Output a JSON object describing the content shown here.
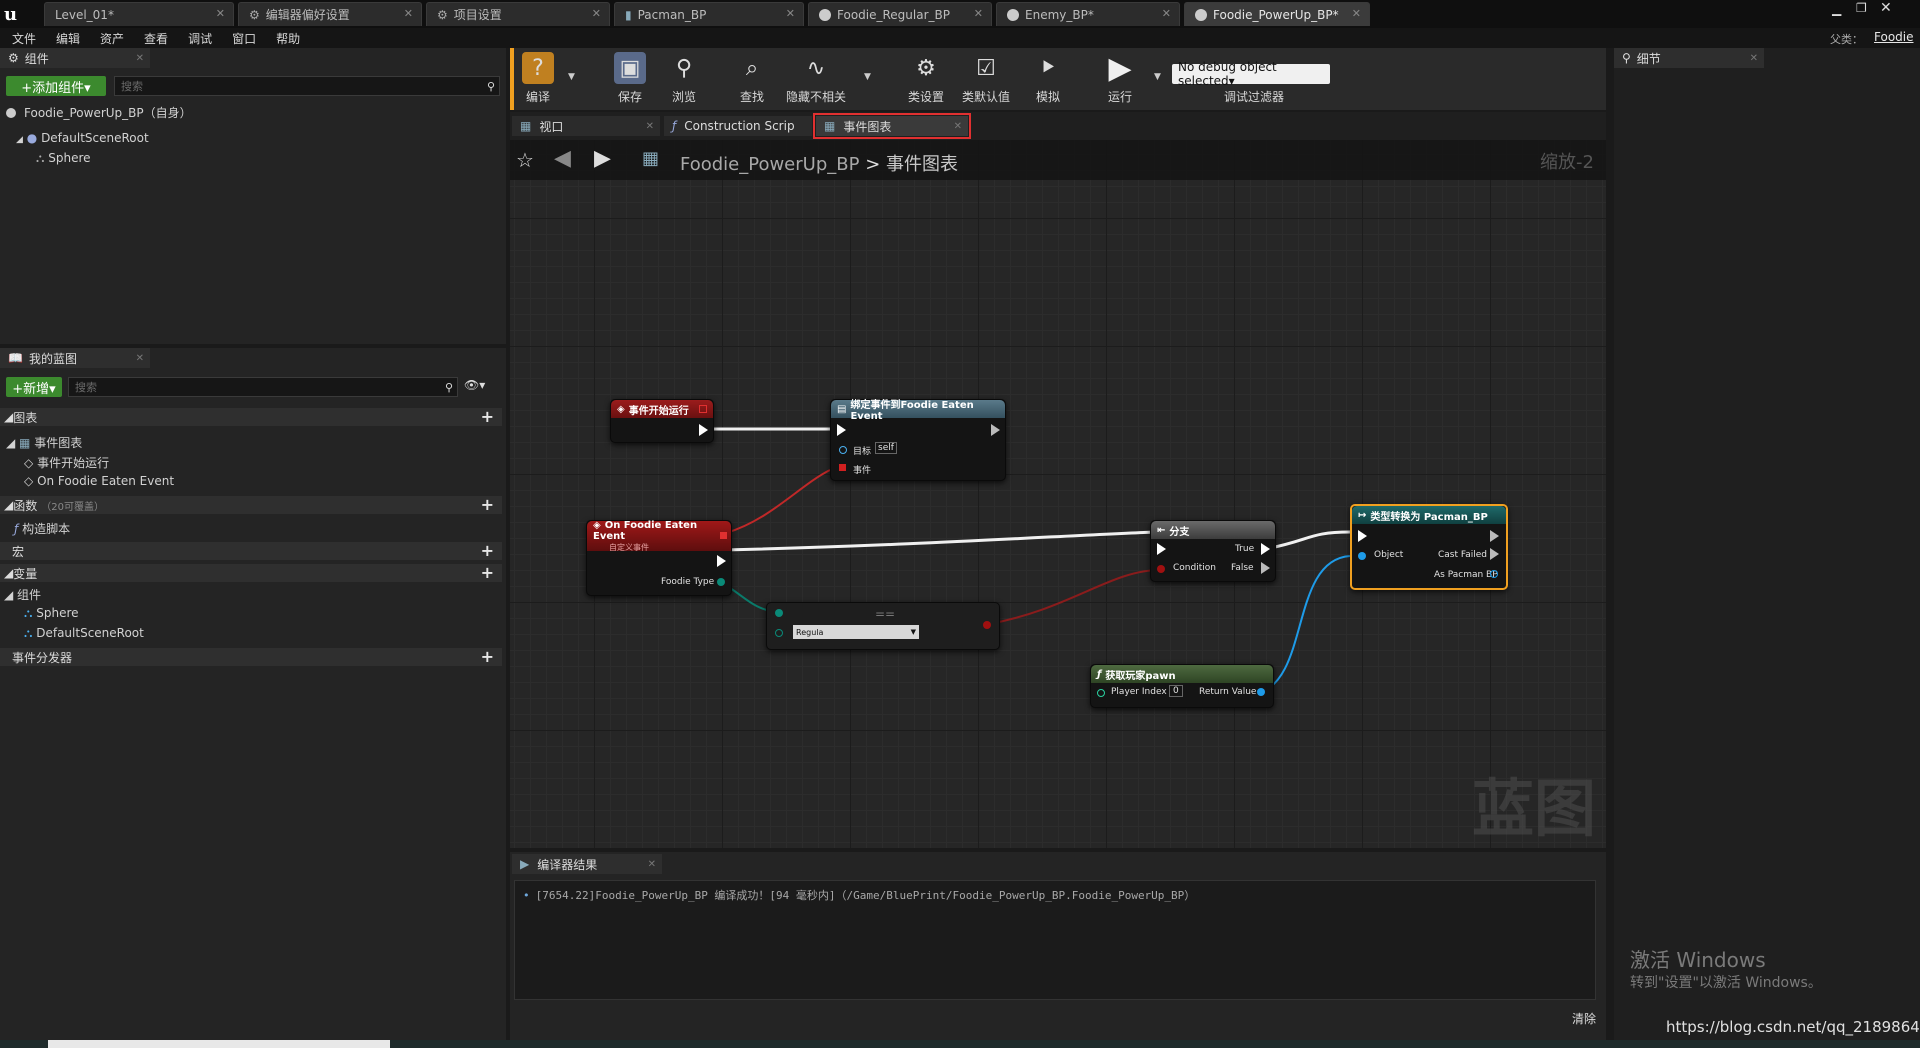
{
  "doc_tabs": [
    {
      "label": "Level_01*"
    },
    {
      "label": "编辑器偏好设置"
    },
    {
      "label": "项目设置"
    },
    {
      "label": "Pacman_BP"
    },
    {
      "label": "Foodie_Regular_BP"
    },
    {
      "label": "Enemy_BP*"
    },
    {
      "label": "Foodie_PowerUp_BP*"
    }
  ],
  "menu": [
    "文件",
    "编辑",
    "资产",
    "查看",
    "调试",
    "窗口",
    "帮助"
  ],
  "parent_class": {
    "label": "父类：",
    "value": "Foodie"
  },
  "components_panel": {
    "tab": "组件",
    "add_button": "+添加组件▾",
    "search_placeholder": "搜索",
    "self_item": "Foodie_PowerUp_BP（自身）",
    "tree": [
      "DefaultSceneRoot",
      "Sphere"
    ]
  },
  "my_blueprint": {
    "tab": "我的蓝图",
    "new_button": "+新增▾",
    "search_placeholder": "搜索",
    "graphs_header": "图表",
    "event_graph": "事件图表",
    "event_graph_items": [
      "事件开始运行",
      "On Foodie Eaten Event"
    ],
    "functions_header": "函数",
    "functions_note": "（20可覆盖）",
    "construction_script": "构造脚本",
    "macros_header": "宏",
    "variables_header": "变量",
    "components_header": "组件",
    "component_items": [
      "Sphere",
      "DefaultSceneRoot"
    ],
    "dispatchers_header": "事件分发器"
  },
  "toolbar": {
    "compile": "编译",
    "save": "保存",
    "browse": "浏览",
    "find": "查找",
    "hide_unrelated": "隐藏不相关",
    "class_settings": "类设置",
    "class_defaults": "类默认值",
    "simulate": "模拟",
    "play": "运行",
    "debug_object": "No debug object selected▾",
    "debug_filter": "调试过滤器"
  },
  "graph_tabs": [
    "视口",
    "Construction Scrip",
    "事件图表"
  ],
  "breadcrumb": {
    "blueprint": "Foodie_PowerUp_BP",
    "separator": ">",
    "graph": "事件图表",
    "zoom": "缩放-2"
  },
  "watermark": "蓝图",
  "nodes": {
    "begin_play": {
      "title": "事件开始运行"
    },
    "bind_event": {
      "title": "绑定事件到Foodie Eaten Event",
      "pin_target": "目标",
      "target_value": "self",
      "pin_event": "事件"
    },
    "custom_event": {
      "title": "On Foodie Eaten Event",
      "subtitle": "自定义事件",
      "pin_foodie_type": "Foodie Type"
    },
    "equals": {
      "title": "==",
      "select_value": "Regula"
    },
    "branch": {
      "title": "分支",
      "pin_true": "True",
      "pin_condition": "Condition",
      "pin_false": "False"
    },
    "cast": {
      "title": "类型转换为 Pacman_BP",
      "pin_object": "Object",
      "pin_cast_failed": "Cast Failed",
      "pin_as": "As Pacman BP"
    },
    "get_pawn": {
      "title": "获取玩家pawn",
      "pin_player_index": "Player Index",
      "player_index_value": "0",
      "pin_return": "Return Value"
    }
  },
  "compiler": {
    "tab": "编译器结果",
    "message": "[7654.22]Foodie_PowerUp_BP 编译成功！[94 毫秒内]（/Game/BluePrint/Foodie_PowerUp_BP.Foodie_PowerUp_BP）",
    "clear": "清除"
  },
  "details_panel": {
    "tab": "细节"
  },
  "activation": {
    "line1": "激活 Windows",
    "line2": "转到\"设置\"以激活 Windows。"
  },
  "url_watermark": "https://blog.csdn.net/qq_21898647",
  "colors": {
    "accent_green": "#3c8a2e",
    "event_red": "#8a1a1a",
    "highlight_orange": "#f0a020",
    "pin_blue": "#1e9be8",
    "pin_red": "#d02020"
  }
}
